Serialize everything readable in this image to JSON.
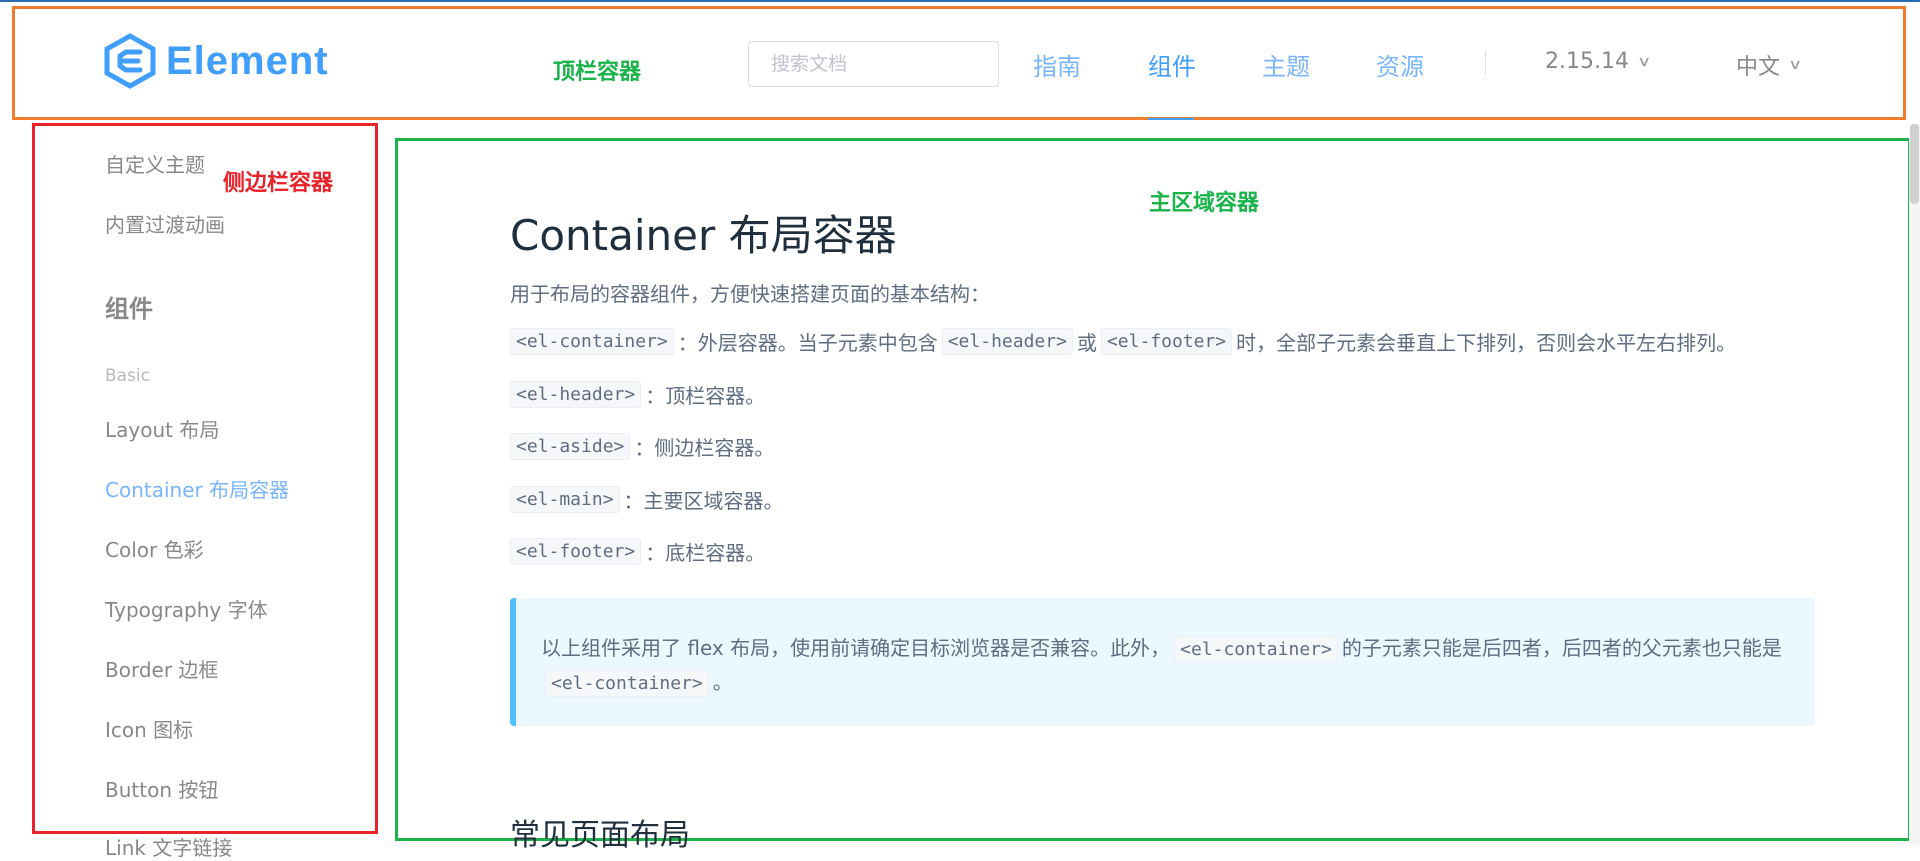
{
  "header": {
    "logo_text": "Element",
    "annotation_label": "顶栏容器",
    "search_placeholder": "搜索文档",
    "nav": [
      "指南",
      "组件",
      "主题",
      "资源"
    ],
    "version": "2.15.14",
    "language": "中文"
  },
  "sidebar": {
    "annotation_label": "侧边栏容器",
    "items_top": [
      "自定义主题",
      "内置过渡动画"
    ],
    "group_title": "组件",
    "group_sub": "Basic",
    "items": [
      "Layout 布局",
      "Container 布局容器",
      "Color 色彩",
      "Typography 字体",
      "Border 边框",
      "Icon 图标",
      "Button 按钮"
    ],
    "active_item": "Container 布局容器",
    "cut_item": "Link 文字链接"
  },
  "main": {
    "annotation_label": "主区域容器",
    "title": "Container 布局容器",
    "intro": "用于布局的容器组件，方便快速搭建页面的基本结构：",
    "p1": {
      "c1": "<el-container>",
      "t1": "：外层容器。当子元素中包含",
      "c2": "<el-header>",
      "t2": "或",
      "c3": "<el-footer>",
      "t3": "时，全部子元素会垂直上下排列，否则会水平左右排列。"
    },
    "p2": {
      "code": "<el-header>",
      "text": "：顶栏容器。"
    },
    "p3": {
      "code": "<el-aside>",
      "text": "：侧边栏容器。"
    },
    "p4": {
      "code": "<el-main>",
      "text": "：主要区域容器。"
    },
    "p5": {
      "code": "<el-footer>",
      "text": "：底栏容器。"
    },
    "tip": {
      "t1": "以上组件采用了 flex 布局，使用前请确定目标浏览器是否兼容。此外，",
      "c1": "<el-container>",
      "t2": "的子元素只能是后四者，后四者的父元素也只能是",
      "c2": "<el-container>",
      "t3": "。"
    },
    "section_title": "常见页面布局"
  },
  "colors": {
    "primary": "#409EFF",
    "header_annotation": "#f07c2e",
    "sidebar_annotation": "#e8232a",
    "main_annotation": "#19b34a"
  }
}
